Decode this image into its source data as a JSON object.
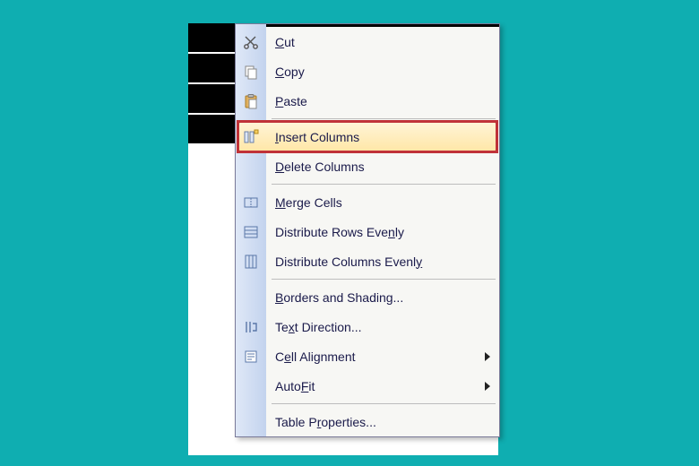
{
  "menu": {
    "items": [
      {
        "pre": "",
        "mn": "C",
        "post": "ut"
      },
      {
        "pre": "",
        "mn": "C",
        "post": "opy"
      },
      {
        "pre": "",
        "mn": "P",
        "post": "aste"
      },
      {
        "pre": "",
        "mn": "I",
        "post": "nsert Columns"
      },
      {
        "pre": "",
        "mn": "D",
        "post": "elete Columns"
      },
      {
        "pre": "",
        "mn": "M",
        "post": "erge Cells"
      },
      {
        "pre": "Distribute Rows Eve",
        "mn": "n",
        "post": "ly"
      },
      {
        "pre": "Distribute Columns Evenl",
        "mn": "y",
        "post": ""
      },
      {
        "pre": "",
        "mn": "B",
        "post": "orders and Shading..."
      },
      {
        "pre": "Te",
        "mn": "x",
        "post": "t Direction..."
      },
      {
        "pre": "C",
        "mn": "e",
        "post": "ll Alignment"
      },
      {
        "pre": "Auto",
        "mn": "F",
        "post": "it"
      },
      {
        "pre": "Table P",
        "mn": "r",
        "post": "operties..."
      }
    ]
  }
}
